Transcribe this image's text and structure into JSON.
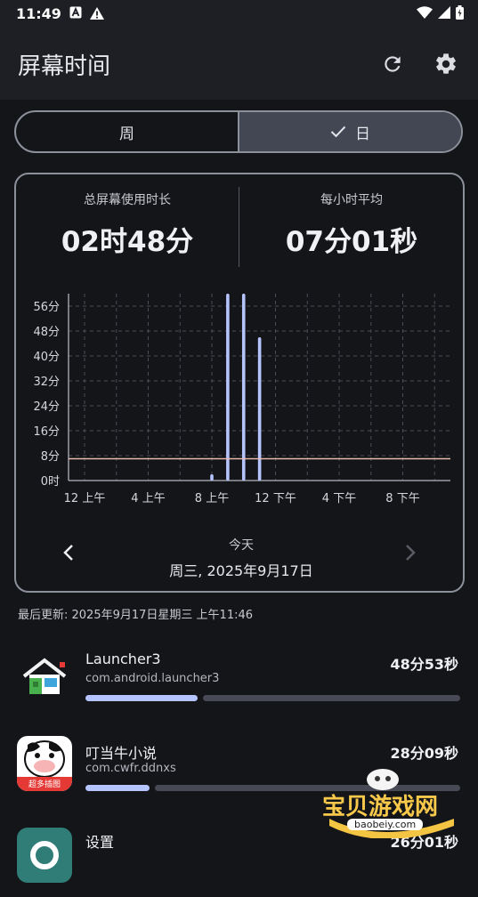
{
  "status_bar": {
    "time": "11:49"
  },
  "app_bar": {
    "title": "屏幕时间"
  },
  "segmented": {
    "week_label": "周",
    "day_label": "日",
    "selected": "日"
  },
  "stats": {
    "total_label": "总屏幕使用时长",
    "total_value": "02时48分",
    "avg_label": "每小时平均",
    "avg_value": "07分01秒"
  },
  "chart_data": {
    "type": "bar",
    "y_tick_labels": [
      "0时",
      "8分",
      "16分",
      "24分",
      "32分",
      "40分",
      "48分",
      "56分"
    ],
    "ylim": [
      0,
      60
    ],
    "x_tick_labels": [
      "12 上午",
      "4 上午",
      "8 上午",
      "12 下午",
      "4 下午",
      "8 下午"
    ],
    "categories": [
      "0",
      "1",
      "2",
      "3",
      "4",
      "5",
      "6",
      "7",
      "8",
      "9",
      "10",
      "11",
      "12",
      "13",
      "14",
      "15",
      "16",
      "17",
      "18",
      "19",
      "20",
      "21",
      "22",
      "23"
    ],
    "values": [
      0,
      0,
      0,
      0,
      0,
      0,
      0,
      0,
      2,
      60,
      60,
      46,
      0,
      0,
      0,
      0,
      0,
      0,
      0,
      0,
      0,
      0,
      0,
      0
    ],
    "average_line": 7,
    "grid": true,
    "colors": {
      "bar": "#b5c4ff",
      "avg_line": "#e7b9ac"
    }
  },
  "date_nav": {
    "sub": "今天",
    "main": "周三, 2025年9月17日"
  },
  "last_update": "最后更新: 2025年9月17日星期三 上午11:46",
  "apps": [
    {
      "name": "Launcher3",
      "package": "com.android.launcher3",
      "time": "48分53秒",
      "fraction": 0.3
    },
    {
      "name": "叮当牛小说",
      "package": "com.cwfr.ddnxs",
      "time": "28分09秒",
      "fraction": 0.17
    },
    {
      "name": "设置",
      "package": "",
      "time": "26分01秒",
      "fraction": 0.15
    }
  ],
  "icon_badge": "超多插图",
  "watermark": {
    "title": "宝贝游戏网",
    "url": "baobeiy.com"
  }
}
